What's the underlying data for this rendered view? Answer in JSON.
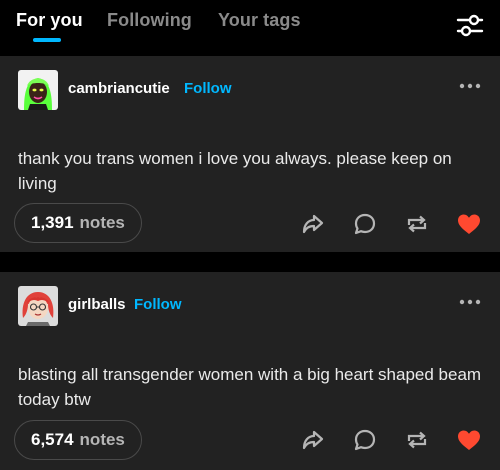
{
  "colors": {
    "background": "#000000",
    "post_background": "#222222",
    "accent_blue": "#00b8ff",
    "heart_red": "#ff4930",
    "icon_gray": "#b5b5b5"
  },
  "header": {
    "tabs": [
      {
        "label": "For you",
        "active": true
      },
      {
        "label": "Following",
        "active": false
      },
      {
        "label": "Your tags",
        "active": false
      }
    ],
    "filter_icon": "sliders-icon"
  },
  "posts": [
    {
      "username": "cambriancutie",
      "follow_label": "Follow",
      "avatar_icon": "avatar-green-hair",
      "text": "thank you trans women i love you always. please keep on living",
      "notes_count": "1,391",
      "notes_label": "notes",
      "actions": [
        "share-icon",
        "reply-icon",
        "reblog-icon",
        "heart-icon"
      ],
      "liked": true
    },
    {
      "username": "girlballs",
      "follow_label": "Follow",
      "avatar_icon": "avatar-red-hair",
      "text": "blasting all transgender women with a big heart shaped beam today btw",
      "notes_count": "6,574",
      "notes_label": "notes",
      "actions": [
        "share-icon",
        "reply-icon",
        "reblog-icon",
        "heart-icon"
      ],
      "liked": true
    }
  ]
}
